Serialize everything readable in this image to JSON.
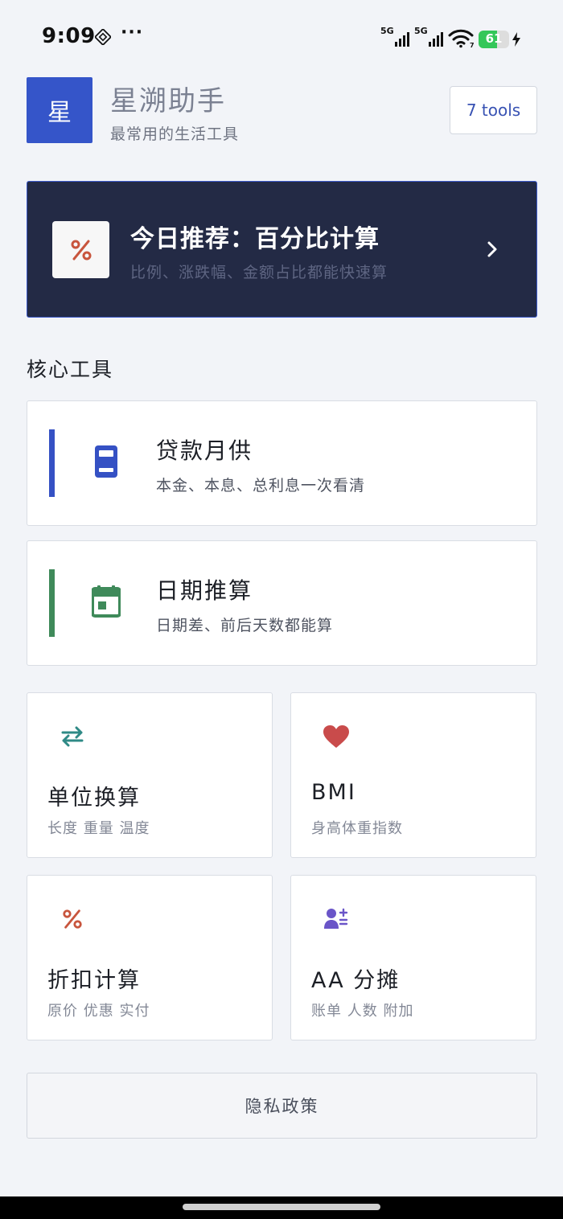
{
  "status_bar": {
    "time": "9:09",
    "more": "···",
    "signal_1_label": "5G",
    "signal_2_label": "5G",
    "wifi_badge": "7",
    "battery_level": "61",
    "battery_fraction": 0.61,
    "battery_color": "#34c759"
  },
  "header": {
    "logo_char": "星",
    "title": "星溯助手",
    "subtitle": "最常用的生活工具",
    "tools_badge": "7 tools",
    "brand_color": "#3555c9"
  },
  "recommendation": {
    "title": "今日推荐：百分比计算",
    "subtitle": "比例、涨跌幅、金额占比都能快速算",
    "icon": "percent-icon",
    "background": "#232a45"
  },
  "core_section": {
    "title": "核心工具"
  },
  "core_tools": [
    {
      "title": "贷款月供",
      "desc": "本金、本息、总利息一次看清",
      "icon": "calculator-icon",
      "accent": "#3551c4"
    },
    {
      "title": "日期推算",
      "desc": "日期差、前后天数都能算",
      "icon": "calendar-icon",
      "accent": "#3f8a5a"
    }
  ],
  "grid_tools": [
    {
      "title": "单位换算",
      "desc": "长度 重量 温度",
      "icon": "swap-arrows-icon",
      "color": "#2f8a86"
    },
    {
      "title": "BMI",
      "desc": "身高体重指数",
      "icon": "heart-icon",
      "color": "#c94b4b"
    },
    {
      "title": "折扣计算",
      "desc": "原价 优惠 实付",
      "icon": "percent-icon",
      "color": "#c8553d"
    },
    {
      "title": "AA 分摊",
      "desc": "账单 人数 附加",
      "icon": "person-add-icon",
      "color": "#6a55c8"
    }
  ],
  "footer": {
    "privacy_label": "隐私政策"
  }
}
